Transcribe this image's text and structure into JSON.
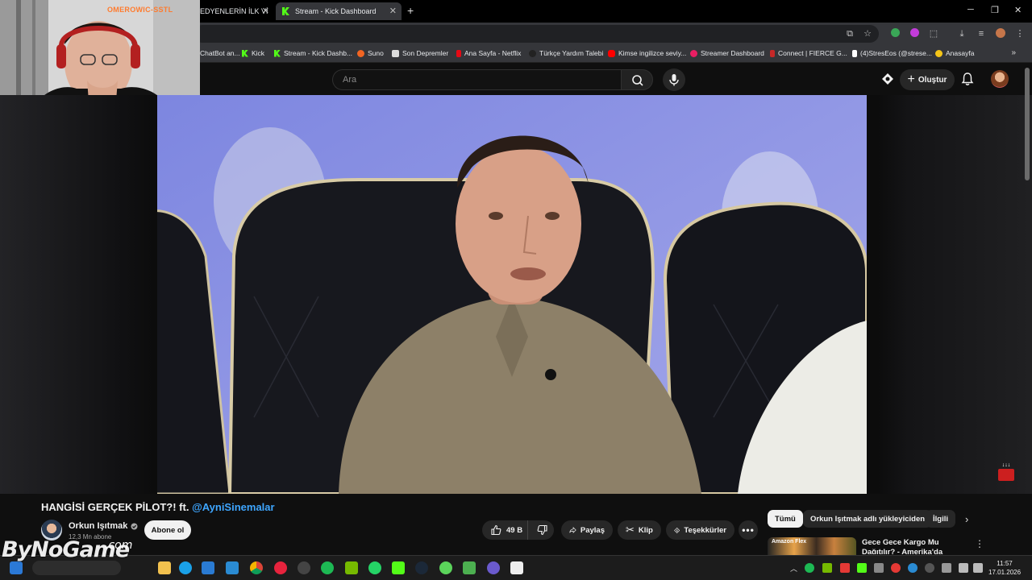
{
  "browser": {
    "tabs": [
      {
        "label": "EDYENLERİN İLK Vİ",
        "active": false
      },
      {
        "label": "Stream - Kick Dashboard",
        "active": true
      }
    ],
    "bookmarks": [
      {
        "label": "ChatBot an...",
        "color": "#4a90d9"
      },
      {
        "label": "Kick",
        "color": "#53fc18"
      },
      {
        "label": "Stream - Kick Dashb...",
        "color": "#53fc18"
      },
      {
        "label": "Suno",
        "color": "#f26522"
      },
      {
        "label": "Son Depremler",
        "color": "#dddddd"
      },
      {
        "label": "Ana Sayfa - Netflix",
        "color": "#e50914"
      },
      {
        "label": "Türkçe Yardım Talebi",
        "color": "#222222"
      },
      {
        "label": "Kimse ingilizce seviy...",
        "color": "#ff0000"
      },
      {
        "label": "Streamer Dashboard",
        "color": "#e91e63"
      },
      {
        "label": "Connect | FIERCE G...",
        "color": "#c62828"
      },
      {
        "label": "(4)StresEos (@strese...",
        "color": "#ffffff"
      },
      {
        "label": "Anasayfa",
        "color": "#f5c518"
      }
    ]
  },
  "webcam": {
    "overlay_name": "OMEROWIC-SSTL"
  },
  "youtube": {
    "search_placeholder": "Ara",
    "create_label": "Oluştur",
    "video_title_text": "HANGİSİ GERÇEK PİLOT?! ft. ",
    "video_title_mention": "@AyniSinemalar",
    "channel_name": "Orkun Işıtmak",
    "channel_subs": "12,3 Mn abone",
    "subscribe_label": "Abone ol",
    "like_count": "49 B",
    "share_label": "Paylaş",
    "clip_label": "Klip",
    "thanks_label": "Teşekkürler",
    "chips": [
      "Tümü",
      "Orkun Işıtmak adlı yükleyiciden",
      "İlgili"
    ],
    "recommendation": {
      "title": "Gece Gece Kargo Mu Dağıtılır? - Amerika'da Amazon Flex",
      "thumb_label": "Amazon Flex"
    }
  },
  "taskbar": {
    "time": "11:57",
    "date": "17.01.2026"
  },
  "watermark": {
    "text": "ByNoGame",
    "suffix": ".com"
  },
  "colors": {
    "accent_link": "#3ea6ff",
    "kick_green": "#53fc18",
    "background": "#0f0f0f"
  }
}
